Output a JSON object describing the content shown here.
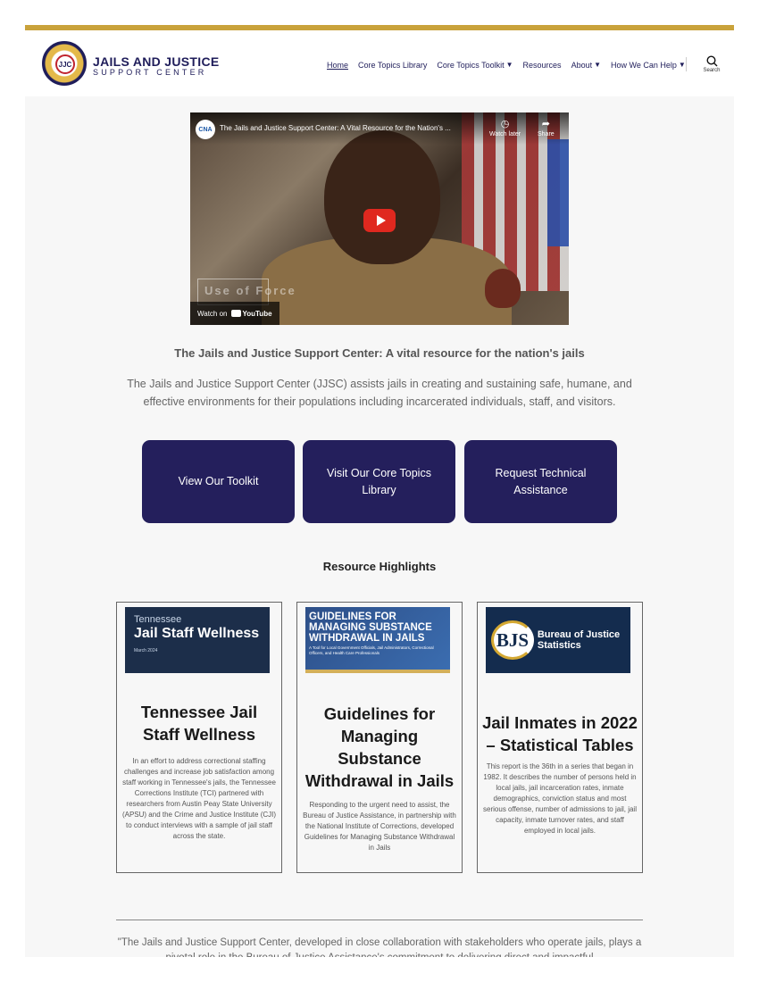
{
  "header": {
    "brand_name": "JAILS AND JUSTICE",
    "brand_sub": "SUPPORT CENTER",
    "logo_text": "JJC",
    "nav": [
      {
        "label": "Home",
        "active": true,
        "dropdown": false
      },
      {
        "label": "Core Topics Library",
        "active": false,
        "dropdown": false
      },
      {
        "label": "Core Topics Toolkit",
        "active": false,
        "dropdown": true
      },
      {
        "label": "Resources",
        "active": false,
        "dropdown": false
      },
      {
        "label": "About",
        "active": false,
        "dropdown": true
      },
      {
        "label": "How We Can Help",
        "active": false,
        "dropdown": true
      }
    ],
    "search_label": "Search"
  },
  "video": {
    "channel_badge": "CNA",
    "title": "The Jails and Justice Support Center: A Vital Resource for the Nation's ...",
    "watch_later": "Watch later",
    "share": "Share",
    "overlay_text": "Use of Force",
    "watch_on": "Watch on",
    "youtube": "YouTube"
  },
  "main": {
    "video_caption": "The Jails and Justice Support Center: A vital resource for the nation's jails",
    "intro": "The Jails and Justice Support Center (JJSC) assists jails in creating and sustaining safe, humane, and effective environments for their populations including incarcerated individuals, staff, and visitors.",
    "cta": [
      {
        "label": "View Our Toolkit"
      },
      {
        "label": "Visit Our Core Topics Library"
      },
      {
        "label": "Request Technical Assistance"
      }
    ],
    "highlights_title": "Resource Highlights",
    "cards": [
      {
        "img_line1": "Tennessee",
        "img_line2": "Jail Staff Wellness",
        "img_line3": "March 2024",
        "title": "Tennessee Jail Staff Wellness",
        "desc": "In an effort to address correctional staffing challenges and increase job satisfaction among staff working in Tennessee's jails, the Tennessee Corrections Institute (TCI) partnered with researchers from Austin Peay State University (APSU) and the Crime and Justice Institute (CJI) to conduct interviews with a sample of jail staff across the state."
      },
      {
        "img_line1": "GUIDELINES FOR MANAGING SUBSTANCE WITHDRAWAL IN JAILS",
        "img_line2": "A Tool for Local Government Officials, Jail Administrators, Correctional Officers, and Health Care Professionals",
        "title": "Guidelines for Managing Substance Withdrawal in Jails",
        "desc": "Responding to the urgent need to assist, the Bureau of Justice Assistance, in partnership with the National Institute of Corrections, developed Guidelines for Managing Substance Withdrawal in Jails"
      },
      {
        "img_mark": "BJS",
        "img_text": "Bureau of Justice Statistics",
        "title": "Jail Inmates in 2022 – Statistical Tables",
        "desc": "This report is the 36th in a series that began in 1982. It describes the number of persons held in local jails, jail incarceration rates, inmate demographics, conviction status and most serious offense, number of admissions to jail, jail capacity, inmate turnover rates, and staff employed in local jails."
      }
    ],
    "quote": "\"The Jails and Justice Support Center, developed in close collaboration with stakeholders who operate jails, plays a pivotal role in the Bureau of Justice Assistance's commitment to delivering direct and impactful"
  },
  "colors": {
    "accent_gold": "#c9a23b",
    "brand_navy": "#241f5c",
    "play_red": "#e0281f"
  }
}
